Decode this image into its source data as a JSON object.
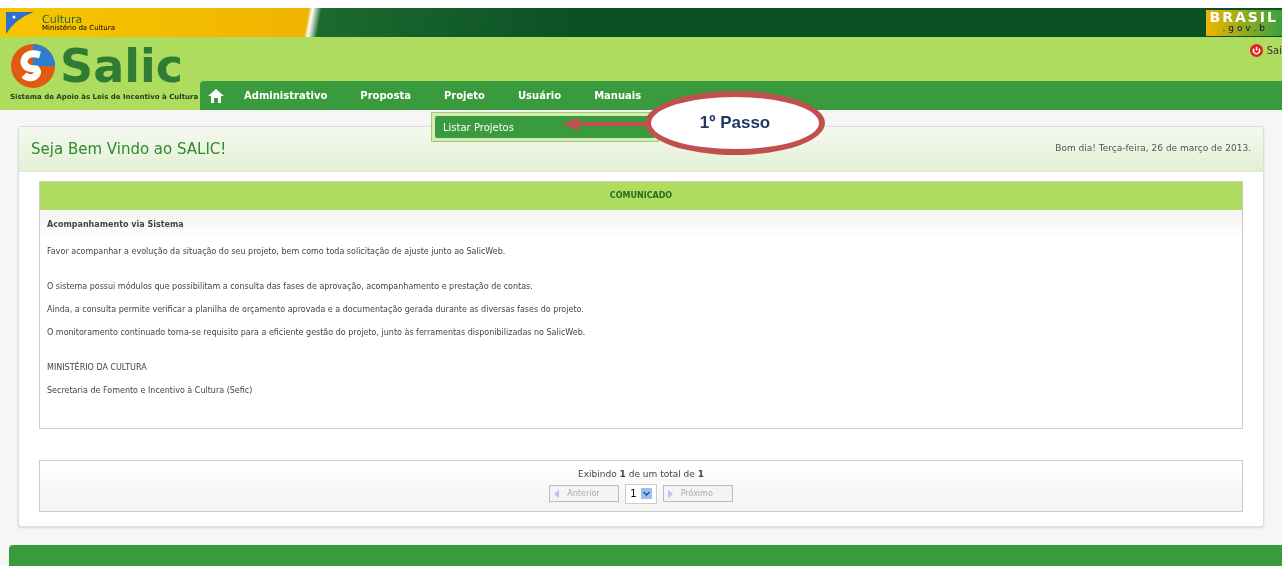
{
  "banner": {
    "ministry": "Cultura",
    "ministry_sub": "Ministério da Cultura",
    "gov_logo": "BRASIL",
    "gov_sub": ". g o v . b"
  },
  "logo": {
    "name": "Salic",
    "tagline": "Sistema de Apoio às Leis de Incentivo à Cultura"
  },
  "logout": "Sai",
  "nav": [
    "Administrativo",
    "Proposta",
    "Projeto",
    "Usuário",
    "Manuais"
  ],
  "dropdown": [
    "Listar Projetos"
  ],
  "annotation": "1º Passo",
  "welcome": "Seja Bem Vindo ao SALIC!",
  "date": "Bom dia! Terça-feira, 26 de março de 2013.",
  "notice": {
    "title": "COMUNICADO",
    "heading": "Acompanhamento via Sistema",
    "sections": [
      [
        "Favor acompanhar a evolução da situação do seu projeto, bem como toda solicitação de ajuste junto ao SalicWeb."
      ],
      [
        "O sistema possui módulos que possibilitam a consulta das fases de aprovação, acompanhamento e prestação de contas.",
        "Ainda, a consulta permite verificar a planilha de orçamento aprovada e a documentação gerada durante as diversas fases do projeto.",
        "O monitoramento continuado torna-se requisito para a eficiente gestão do projeto, junto às ferramentas disponibilizadas no SalicWeb."
      ],
      [
        "MINISTÉRIO DA CULTURA",
        "Secretaria de Fomento e Incentivo à Cultura (Sefic)"
      ]
    ]
  },
  "pagination": {
    "summary": "Exibindo **1** de um total de **1**",
    "prev": {
      "label": "Anterior",
      "disabled": true
    },
    "page": "1",
    "next": {
      "label": "Próximo",
      "disabled": true
    }
  }
}
